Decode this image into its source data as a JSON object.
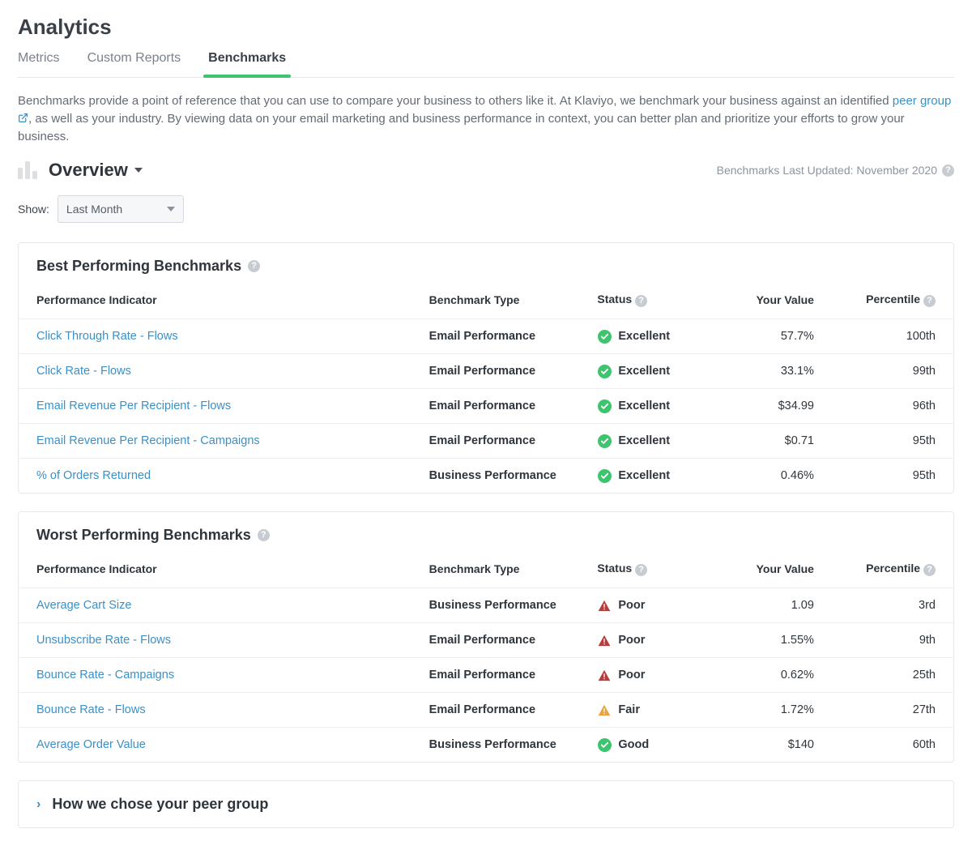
{
  "page_title": "Analytics",
  "tabs": [
    "Metrics",
    "Custom Reports",
    "Benchmarks"
  ],
  "active_tab": 2,
  "intro_pre": "Benchmarks provide a point of reference that you can use to compare your business to others like it. At Klaviyo, we benchmark your business against an identified ",
  "intro_link": "peer group",
  "intro_post": ", as well as your industry. By viewing data on your email marketing and business performance in context, you can better plan and prioritize your efforts to grow your business.",
  "overview_label": "Overview",
  "last_updated": "Benchmarks Last Updated: November 2020",
  "filter_label": "Show:",
  "filter_value": "Last Month",
  "columns": {
    "indicator": "Performance Indicator",
    "type": "Benchmark Type",
    "status": "Status",
    "value": "Your Value",
    "percentile": "Percentile"
  },
  "best": {
    "title": "Best Performing Benchmarks",
    "rows": [
      {
        "indicator": "Click Through Rate - Flows",
        "type": "Email Performance",
        "status": "Excellent",
        "status_kind": "excellent",
        "value": "57.7%",
        "percentile": "100th"
      },
      {
        "indicator": "Click Rate - Flows",
        "type": "Email Performance",
        "status": "Excellent",
        "status_kind": "excellent",
        "value": "33.1%",
        "percentile": "99th"
      },
      {
        "indicator": "Email Revenue Per Recipient - Flows",
        "type": "Email Performance",
        "status": "Excellent",
        "status_kind": "excellent",
        "value": "$34.99",
        "percentile": "96th"
      },
      {
        "indicator": "Email Revenue Per Recipient - Campaigns",
        "type": "Email Performance",
        "status": "Excellent",
        "status_kind": "excellent",
        "value": "$0.71",
        "percentile": "95th"
      },
      {
        "indicator": "% of Orders Returned",
        "type": "Business Performance",
        "status": "Excellent",
        "status_kind": "excellent",
        "value": "0.46%",
        "percentile": "95th"
      }
    ]
  },
  "worst": {
    "title": "Worst Performing Benchmarks",
    "rows": [
      {
        "indicator": "Average Cart Size",
        "type": "Business Performance",
        "status": "Poor",
        "status_kind": "poor",
        "value": "1.09",
        "percentile": "3rd"
      },
      {
        "indicator": "Unsubscribe Rate - Flows",
        "type": "Email Performance",
        "status": "Poor",
        "status_kind": "poor",
        "value": "1.55%",
        "percentile": "9th"
      },
      {
        "indicator": "Bounce Rate - Campaigns",
        "type": "Email Performance",
        "status": "Poor",
        "status_kind": "poor",
        "value": "0.62%",
        "percentile": "25th"
      },
      {
        "indicator": "Bounce Rate - Flows",
        "type": "Email Performance",
        "status": "Fair",
        "status_kind": "fair",
        "value": "1.72%",
        "percentile": "27th"
      },
      {
        "indicator": "Average Order Value",
        "type": "Business Performance",
        "status": "Good",
        "status_kind": "good",
        "value": "$140",
        "percentile": "60th"
      }
    ]
  },
  "expander_label": "How we chose your peer group",
  "status_colors": {
    "excellent": "#3ec36f",
    "good": "#3ec36f",
    "fair": "#e8a33d",
    "poor": "#b83c3a"
  }
}
